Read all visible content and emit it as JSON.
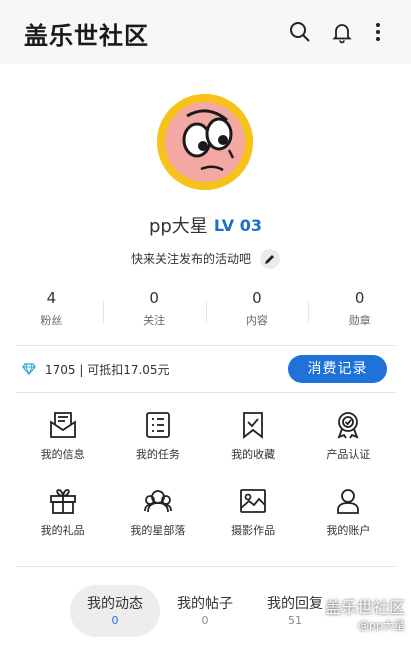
{
  "header": {
    "app_title": "盖乐世社区"
  },
  "profile": {
    "username": "pp大星",
    "level": "LV 03",
    "bio": "快来关注发布的活动吧"
  },
  "stats": [
    {
      "value": "4",
      "label": "粉丝"
    },
    {
      "value": "0",
      "label": "关注"
    },
    {
      "value": "0",
      "label": "内容"
    },
    {
      "value": "0",
      "label": "勋章"
    }
  ],
  "points": {
    "text": "1705 | 可抵扣17.05元",
    "button": "消费记录"
  },
  "features": [
    {
      "label": "我的信息",
      "icon": "mail-icon"
    },
    {
      "label": "我的任务",
      "icon": "task-list-icon"
    },
    {
      "label": "我的收藏",
      "icon": "bookmark-icon"
    },
    {
      "label": "产品认证",
      "icon": "certificate-badge-icon"
    },
    {
      "label": "我的礼品",
      "icon": "gift-icon"
    },
    {
      "label": "我的星部落",
      "icon": "group-icon"
    },
    {
      "label": "摄影作品",
      "icon": "photo-icon"
    },
    {
      "label": "我的账户",
      "icon": "account-icon"
    }
  ],
  "tabs": [
    {
      "label": "我的动态",
      "count": "0",
      "active": true
    },
    {
      "label": "我的帖子",
      "count": "0",
      "active": false
    },
    {
      "label": "我的回复",
      "count": "51",
      "active": false
    }
  ],
  "watermark": {
    "line1": "盖乐世社区",
    "line2": "@pp大星"
  },
  "colors": {
    "accent": "#1e72d8",
    "level": "#1e6fc9",
    "avatar_bg": "#f7c31a"
  }
}
